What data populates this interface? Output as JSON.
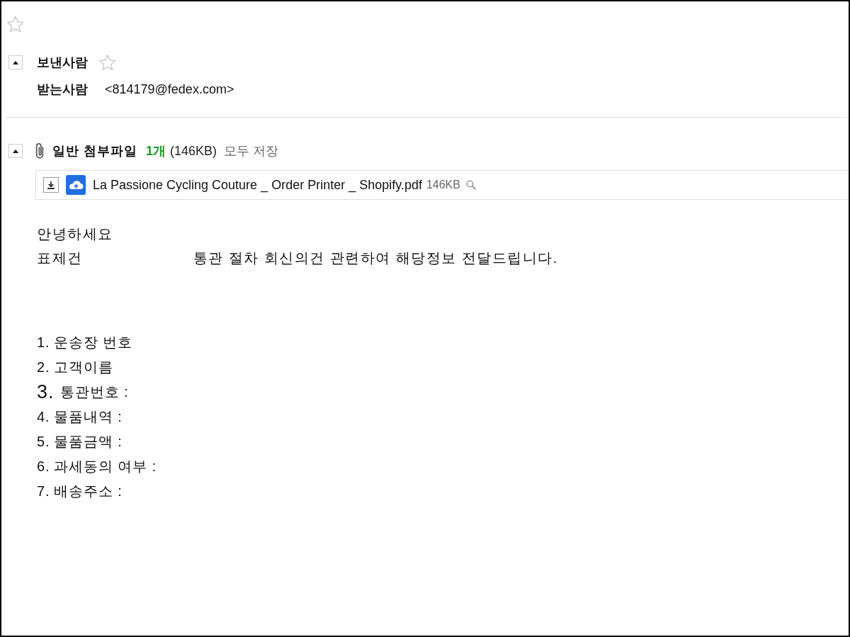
{
  "toolbar": {
    "starred": false
  },
  "message": {
    "expanded": true,
    "sender": {
      "label": "보낸사람",
      "starred": false
    },
    "recipient": {
      "label": "받는사람",
      "value": "<814179@fedex.com>"
    }
  },
  "attachments": {
    "expanded": true,
    "title": "일반 첨부파일",
    "count": "1개",
    "total_size": "(146KB)",
    "save_all": "모두 저장",
    "files": [
      {
        "name": "La Passione Cycling Couture _ Order Printer _ Shopify.pdf",
        "size": "146KB"
      }
    ]
  },
  "body": {
    "greeting": "안녕하세요",
    "intro": {
      "subject": "표제건",
      "text": "통관 절차 회신의건 관련하여 해당정보 전달드립니다."
    },
    "items": [
      {
        "kind": "normal",
        "number": "1.",
        "label": "운송장 번호"
      },
      {
        "kind": "normal",
        "number": "2.",
        "label": "고객이름"
      },
      {
        "kind": "enlarged",
        "number": "3.",
        "label": "통관번호 :"
      },
      {
        "kind": "normal",
        "number": "4.",
        "label": "물품내역 :"
      },
      {
        "kind": "normal",
        "number": "5.",
        "label": "물품금액 :"
      },
      {
        "kind": "normal",
        "number": "6.",
        "label": "과세동의 여부 :"
      },
      {
        "kind": "normal",
        "number": "7.",
        "label": "배송주소 :"
      }
    ]
  }
}
